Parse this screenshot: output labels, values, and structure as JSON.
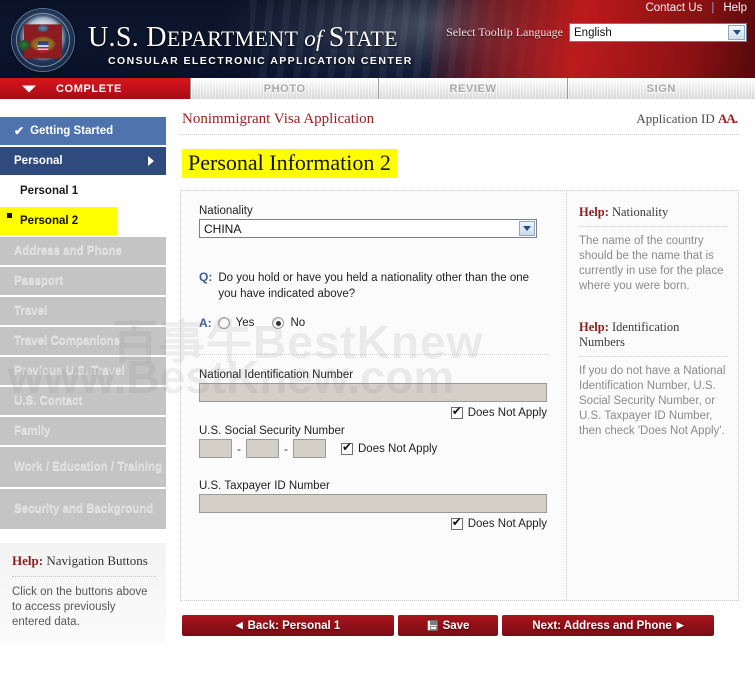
{
  "header": {
    "title_us": "U.S. ",
    "title_dept": "D",
    "title_dept_rest": "EPARTMENT",
    "title_of": " of ",
    "title_state_s": "S",
    "title_state_rest": "TATE",
    "subtitle": "CONSULAR ELECTRONIC APPLICATION CENTER",
    "seal_name": "us-department-of-state-seal",
    "links": [
      {
        "label": "Contact Us"
      },
      {
        "label": "Help"
      }
    ],
    "language": {
      "label": "Select Tooltip Language",
      "value": "English",
      "options": [
        "English"
      ]
    }
  },
  "progress_tabs": [
    {
      "label": "COMPLETE",
      "state": "active"
    },
    {
      "label": "PHOTO",
      "state": "todo"
    },
    {
      "label": "REVIEW",
      "state": "todo"
    },
    {
      "label": "SIGN",
      "state": "todo"
    }
  ],
  "sidebar": {
    "items": [
      {
        "label": "Getting Started",
        "state": "completed"
      },
      {
        "label": "Personal",
        "state": "open-group"
      },
      {
        "label": "Personal 1",
        "state": "sub"
      },
      {
        "label": "Personal 2",
        "state": "sub-current"
      },
      {
        "label": "Address and Phone",
        "state": "disabled"
      },
      {
        "label": "Passport",
        "state": "disabled"
      },
      {
        "label": "Travel",
        "state": "disabled"
      },
      {
        "label": "Travel Companions",
        "state": "disabled"
      },
      {
        "label": "Previous U.S. Travel",
        "state": "disabled"
      },
      {
        "label": "U.S. Contact",
        "state": "disabled"
      },
      {
        "label": "Family",
        "state": "disabled"
      },
      {
        "label": "Work / Education / Training",
        "state": "disabled-two-line"
      },
      {
        "label": "Security and Background",
        "state": "disabled-two-line"
      }
    ],
    "help": {
      "title_prefix": "Help:",
      "title_rest": " Navigation Buttons",
      "body": "Click on the buttons above to access previously entered data."
    }
  },
  "breadcrumb": {
    "form_name": "Nonimmigrant Visa Application",
    "app_id_label": "Application ID ",
    "app_id_value": "AA."
  },
  "page": {
    "title": "Personal Information 2"
  },
  "form": {
    "nationality": {
      "label": "Nationality",
      "value": "CHINA",
      "options": [
        "CHINA"
      ]
    },
    "other_nationality": {
      "q_marker": "Q:",
      "question": "Do you hold or have you held a nationality other than the one you have indicated above?",
      "a_marker": "A:",
      "yes_label": "Yes",
      "no_label": "No",
      "selected": "No"
    },
    "national_id": {
      "label": "National Identification Number",
      "value": "",
      "does_not_apply_label": "Does Not Apply",
      "does_not_apply_checked": true
    },
    "ssn": {
      "label": "U.S. Social Security Number",
      "part1": "",
      "part2": "",
      "part3": "",
      "separator": "-",
      "does_not_apply_label": "Does Not Apply",
      "does_not_apply_checked": true
    },
    "taxpayer_id": {
      "label": "U.S. Taxpayer ID Number",
      "value": "",
      "does_not_apply_label": "Does Not Apply",
      "does_not_apply_checked": true
    }
  },
  "help_panels": [
    {
      "title_prefix": "Help:",
      "title_rest": " Nationality",
      "body": "The name of the country should be the name that is currently in use for the place where you were born."
    },
    {
      "title_prefix": "Help:",
      "title_rest": " Identification Numbers",
      "body": "If you do not have a National Identification Number, U.S. Social Security Number, or U.S. Taxpayer ID Number, then check 'Does Not Apply'."
    }
  ],
  "footer_buttons": {
    "back": {
      "label": "Back: Personal 1",
      "arrow": "◀"
    },
    "save": {
      "label": "Save"
    },
    "next": {
      "label": "Next: Address and Phone",
      "arrow": "▶"
    }
  },
  "watermark": {
    "line1": "百事牛BestKnew",
    "line2": "www.BestKnew.com"
  },
  "colors": {
    "brand_red": "#a9151c",
    "header_navy": "#0d1831",
    "highlight_yellow": "#ffff00",
    "nav_blue": "#4f73ac",
    "nav_blue_dark": "#2f4a7c"
  }
}
